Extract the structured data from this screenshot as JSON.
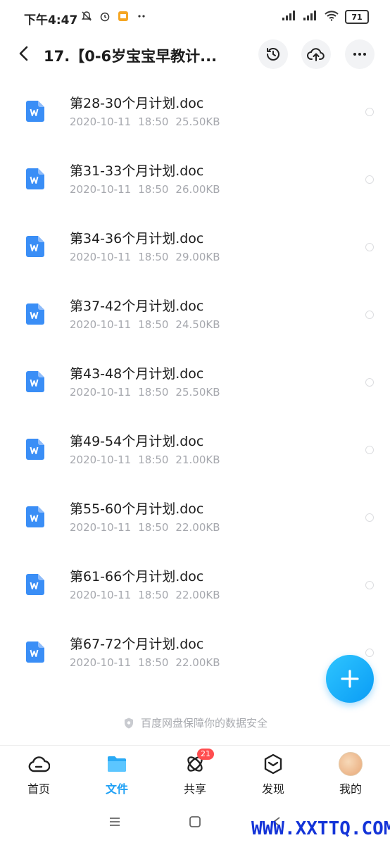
{
  "status": {
    "time": "下午4:47",
    "battery": "71"
  },
  "header": {
    "title": "17.【0-6岁宝宝早教计..."
  },
  "files": [
    {
      "name": "第28-30个月计划.doc",
      "date": "2020-10-11",
      "time": "18:50",
      "size": "25.50KB"
    },
    {
      "name": "第31-33个月计划.doc",
      "date": "2020-10-11",
      "time": "18:50",
      "size": "26.00KB"
    },
    {
      "name": "第34-36个月计划.doc",
      "date": "2020-10-11",
      "time": "18:50",
      "size": "29.00KB"
    },
    {
      "name": "第37-42个月计划.doc",
      "date": "2020-10-11",
      "time": "18:50",
      "size": "24.50KB"
    },
    {
      "name": "第43-48个月计划.doc",
      "date": "2020-10-11",
      "time": "18:50",
      "size": "25.50KB"
    },
    {
      "name": "第49-54个月计划.doc",
      "date": "2020-10-11",
      "time": "18:50",
      "size": "21.00KB"
    },
    {
      "name": "第55-60个月计划.doc",
      "date": "2020-10-11",
      "time": "18:50",
      "size": "22.00KB"
    },
    {
      "name": "第61-66个月计划.doc",
      "date": "2020-10-11",
      "time": "18:50",
      "size": "22.00KB"
    },
    {
      "name": "第67-72个月计划.doc",
      "date": "2020-10-11",
      "time": "18:50",
      "size": "22.00KB"
    }
  ],
  "footer_note": "百度网盘保障你的数据安全",
  "tabs": {
    "home": "首页",
    "files": "文件",
    "share": "共享",
    "share_badge": "21",
    "discover": "发现",
    "mine": "我的"
  },
  "watermark": "WWW.XXTTQ.COM",
  "colors": {
    "accent": "#1ea0f5",
    "badge": "#ff4d4f",
    "doc_icon": "#3a8ef6"
  }
}
